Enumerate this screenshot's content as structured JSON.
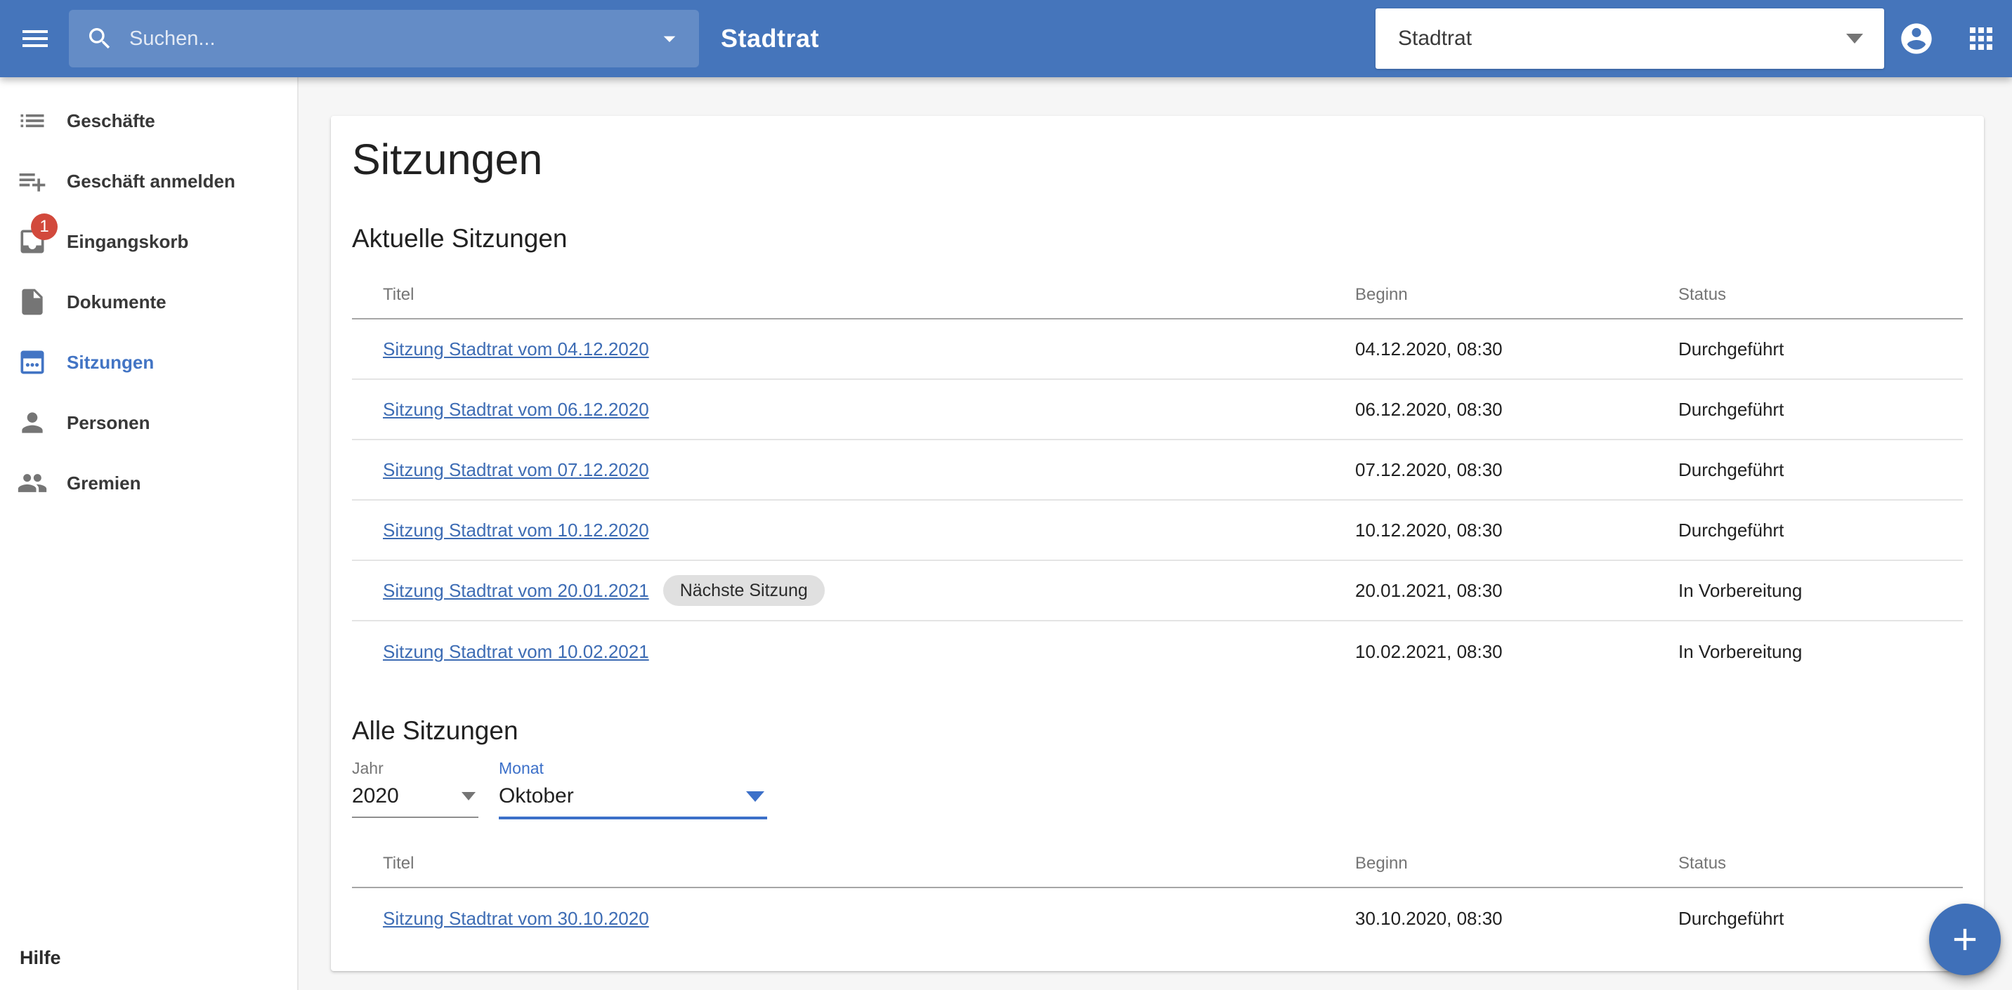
{
  "topbar": {
    "search_placeholder": "Suchen...",
    "app_title": "Stadtrat",
    "context_select_value": "Stadtrat"
  },
  "sidebar": {
    "items": [
      {
        "label": "Geschäfte",
        "icon": "list-icon",
        "active": false
      },
      {
        "label": "Geschäft anmelden",
        "icon": "playlist-add-icon",
        "active": false
      },
      {
        "label": "Eingangskorb",
        "icon": "inbox-icon",
        "badge": "1",
        "active": false
      },
      {
        "label": "Dokumente",
        "icon": "document-icon",
        "active": false
      },
      {
        "label": "Sitzungen",
        "icon": "calendar-icon",
        "active": true
      },
      {
        "label": "Personen",
        "icon": "person-icon",
        "active": false
      },
      {
        "label": "Gremien",
        "icon": "people-icon",
        "active": false
      }
    ],
    "help_label": "Hilfe"
  },
  "page": {
    "title": "Sitzungen",
    "sections": {
      "current": {
        "heading": "Aktuelle Sitzungen",
        "columns": {
          "title": "Titel",
          "begin": "Beginn",
          "status": "Status"
        },
        "rows": [
          {
            "title": "Sitzung Stadtrat vom 04.12.2020",
            "begin": "04.12.2020, 08:30",
            "status": "Durchgeführt"
          },
          {
            "title": "Sitzung Stadtrat vom 06.12.2020",
            "begin": "06.12.2020, 08:30",
            "status": "Durchgeführt"
          },
          {
            "title": "Sitzung Stadtrat vom 07.12.2020",
            "begin": "07.12.2020, 08:30",
            "status": "Durchgeführt"
          },
          {
            "title": "Sitzung Stadtrat vom 10.12.2020",
            "begin": "10.12.2020, 08:30",
            "status": "Durchgeführt"
          },
          {
            "title": "Sitzung Stadtrat vom 20.01.2021",
            "chip": "Nächste Sitzung",
            "begin": "20.01.2021, 08:30",
            "status": "In Vorbereitung"
          },
          {
            "title": "Sitzung Stadtrat vom 10.02.2021",
            "begin": "10.02.2021, 08:30",
            "status": "In Vorbereitung"
          }
        ]
      },
      "all": {
        "heading": "Alle Sitzungen",
        "filters": {
          "year_label": "Jahr",
          "year_value": "2020",
          "month_label": "Monat",
          "month_value": "Oktober"
        },
        "columns": {
          "title": "Titel",
          "begin": "Beginn",
          "status": "Status"
        },
        "rows": [
          {
            "title": "Sitzung Stadtrat vom 30.10.2020",
            "begin": "30.10.2020, 08:30",
            "status": "Durchgeführt"
          }
        ]
      }
    }
  },
  "fab": {
    "icon": "plus-icon"
  },
  "colors": {
    "brand_blue": "#4575bb",
    "active_blue": "#4274c4",
    "link_blue": "#3d6cb4",
    "accent_blue": "#3c70c9",
    "badge_red": "#d2493c",
    "chip_gray": "#e0e0e0"
  }
}
